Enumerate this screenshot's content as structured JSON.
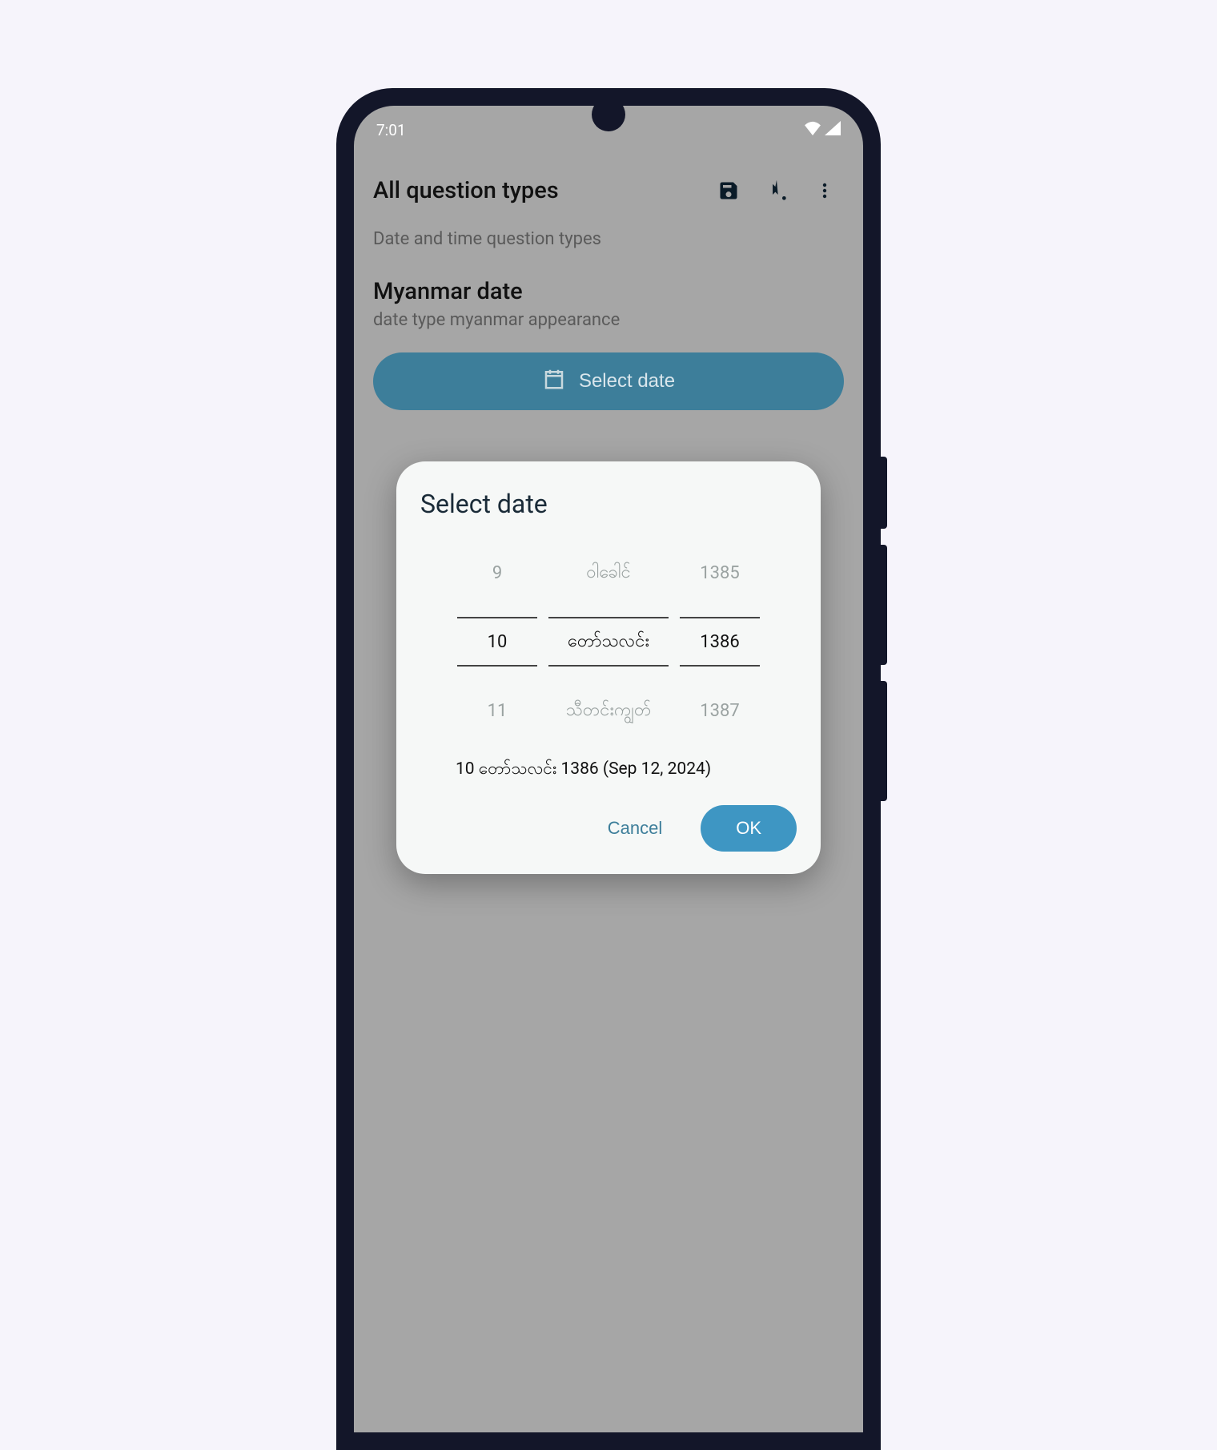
{
  "status": {
    "time": "7:01"
  },
  "appbar": {
    "title": "All question types"
  },
  "section": {
    "label": "Date and time question types"
  },
  "question": {
    "title": "Myanmar date",
    "subtitle": "date type myanmar appearance"
  },
  "select_button": {
    "label": "Select date"
  },
  "dialog": {
    "title": "Select date",
    "picker": {
      "day": {
        "prev": "9",
        "selected": "10",
        "next": "11"
      },
      "month": {
        "prev": "ဝါခေါင်",
        "selected": "တော်သလင်း",
        "next": "သီတင်းကျွတ်"
      },
      "year": {
        "prev": "1385",
        "selected": "1386",
        "next": "1387"
      }
    },
    "selected_text": "10 တော်သလင်း 1386 (Sep 12, 2024)",
    "cancel": "Cancel",
    "ok": "OK"
  }
}
